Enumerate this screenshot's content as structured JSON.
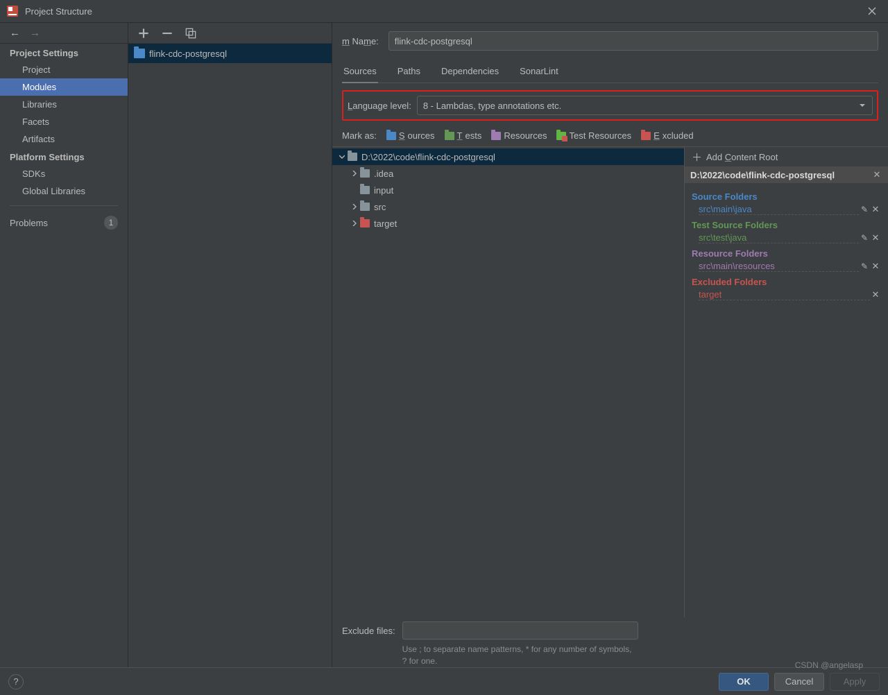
{
  "window": {
    "title": "Project Structure"
  },
  "sidebar": {
    "cat_project": "Project Settings",
    "cat_platform": "Platform Settings",
    "items": {
      "project": "Project",
      "modules": "Modules",
      "libraries": "Libraries",
      "facets": "Facets",
      "artifacts": "Artifacts",
      "sdks": "SDKs",
      "global_libraries": "Global Libraries",
      "problems": "Problems"
    },
    "problems_count": "1"
  },
  "modules": {
    "entry": "flink-cdc-postgresql"
  },
  "detail": {
    "name_label": "Name:",
    "name_value": "flink-cdc-postgresql",
    "tabs": {
      "sources": "Sources",
      "paths": "Paths",
      "dependencies": "Dependencies",
      "sonar": "SonarLint"
    },
    "lang_label": "Language level:",
    "lang_value": "8 - Lambdas, type annotations etc.",
    "mark_label": "Mark as:",
    "mark": {
      "sources": "Sources",
      "tests": "Tests",
      "resources": "Resources",
      "test_resources": "Test Resources",
      "excluded": "Excluded"
    },
    "tree": {
      "root": "D:\\2022\\code\\flink-cdc-postgresql",
      "children": [
        {
          "name": ".idea",
          "expandable": true,
          "excluded": false
        },
        {
          "name": "input",
          "expandable": false,
          "excluded": false
        },
        {
          "name": "src",
          "expandable": true,
          "excluded": false
        },
        {
          "name": "target",
          "expandable": true,
          "excluded": true
        }
      ]
    },
    "roots": {
      "add_label": "Add Content Root",
      "root_path": "D:\\2022\\code\\flink-cdc-postgresql",
      "groups": [
        {
          "title": "Source Folders",
          "cls": "source",
          "items": [
            "src\\main\\java"
          ],
          "editable": true
        },
        {
          "title": "Test Source Folders",
          "cls": "test",
          "items": [
            "src\\test\\java"
          ],
          "editable": true
        },
        {
          "title": "Resource Folders",
          "cls": "resource",
          "items": [
            "src\\main\\resources"
          ],
          "editable": true
        },
        {
          "title": "Excluded Folders",
          "cls": "excluded",
          "items": [
            "target"
          ],
          "editable": false
        }
      ]
    },
    "exclude": {
      "label": "Exclude files:",
      "hint": "Use ; to separate name patterns, * for any number of symbols, ? for one."
    }
  },
  "footer": {
    "ok": "OK",
    "cancel": "Cancel",
    "apply": "Apply"
  },
  "watermark": "CSDN @angelasp"
}
